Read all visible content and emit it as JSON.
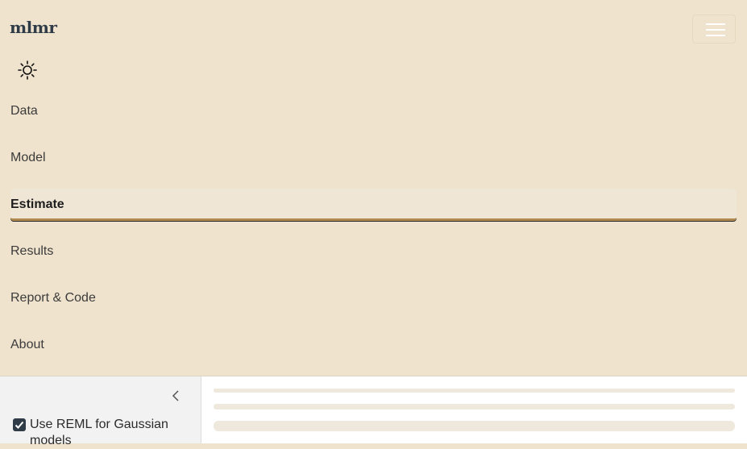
{
  "brand": "mlmr",
  "nav": {
    "items": [
      {
        "label": "Data"
      },
      {
        "label": "Model"
      },
      {
        "label": "Estimate",
        "active": true
      },
      {
        "label": "Results"
      },
      {
        "label": "Report & Code"
      },
      {
        "label": "About"
      }
    ]
  },
  "sidebar": {
    "reml_label": "Use REML for Gaussian models",
    "reml_checked": true
  },
  "colors": {
    "navbar_bg": "#efe3cd",
    "accent": "#b08a4f",
    "checkbox": "#2f3b46"
  },
  "icons": {
    "theme": "sun-icon",
    "menu": "hamburger-menu-icon",
    "collapse": "chevron-left-icon"
  }
}
